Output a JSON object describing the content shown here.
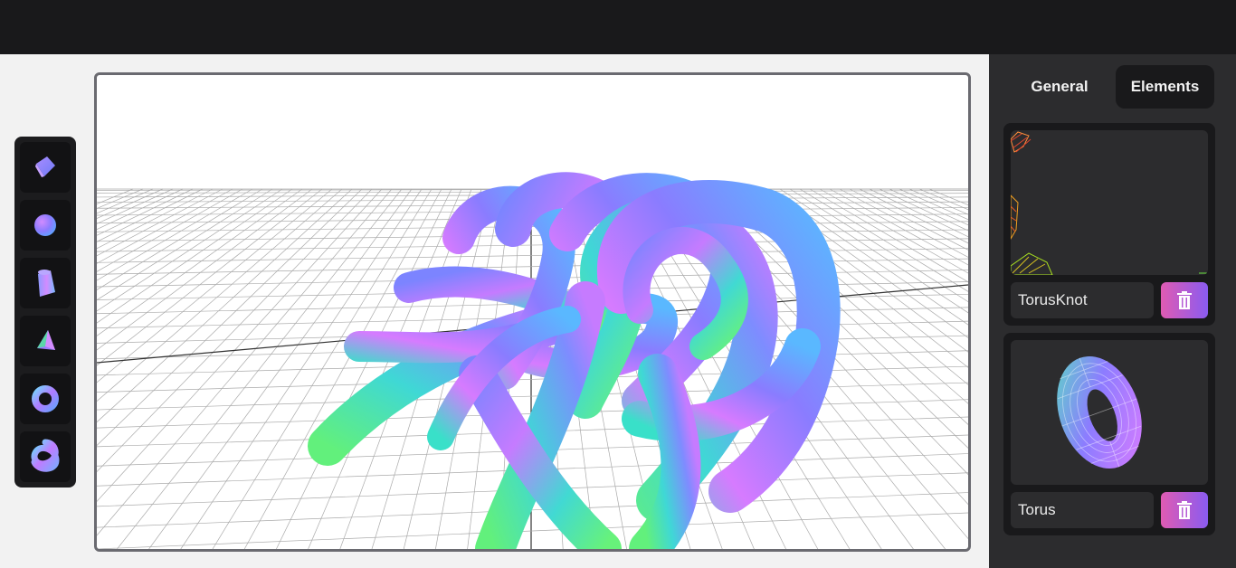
{
  "panel": {
    "tabs": [
      {
        "label": "General",
        "active": false
      },
      {
        "label": "Elements",
        "active": true
      }
    ],
    "elements": [
      {
        "name": "TorusKnot",
        "delete_icon": "trash-icon"
      },
      {
        "name": "Torus",
        "delete_icon": "trash-icon"
      }
    ]
  },
  "toolbar": {
    "tools": [
      "cube-icon",
      "sphere-icon",
      "cylinder-icon",
      "cone-icon",
      "torus-icon",
      "torus-knot-icon"
    ]
  },
  "colors": {
    "topbar": "#19191b",
    "panel": "#2c2c2e",
    "card": "#19191b",
    "delete_gradient_start": "#e05bb3",
    "delete_gradient_end": "#8a5bf0"
  }
}
